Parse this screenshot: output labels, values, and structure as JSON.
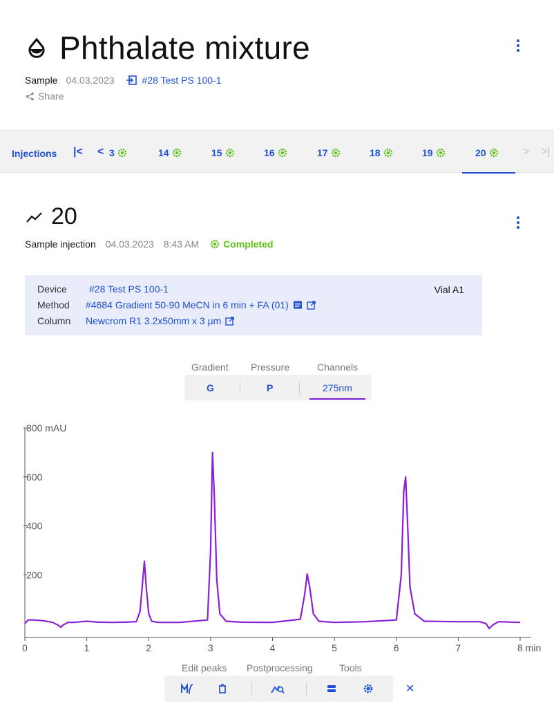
{
  "header": {
    "title": "Phthalate mixture",
    "sample_label": "Sample",
    "sample_date": "04.03.2023",
    "device_link": "#28 Test PS 100-1",
    "share_label": "Share"
  },
  "injections": {
    "label": "Injections",
    "items": [
      {
        "num": "3"
      },
      {
        "num": "14"
      },
      {
        "num": "15"
      },
      {
        "num": "16"
      },
      {
        "num": "17"
      },
      {
        "num": "18"
      },
      {
        "num": "19"
      },
      {
        "num": "20",
        "active": true
      }
    ]
  },
  "run": {
    "number": "20",
    "type_label": "Sample injection",
    "date": "04.03.2023",
    "time": "8:43 AM",
    "status": "Completed"
  },
  "info": {
    "device_key": "Device",
    "device_val": "#28 Test PS 100-1",
    "method_key": "Method",
    "method_val": "#4684 Gradient 50-90 MeCN in 6 min + FA (01)",
    "column_key": "Column",
    "column_val": "Newcrom R1 3.2x50mm x 3 µm",
    "vial": "Vial A1"
  },
  "view_tabs": {
    "gradient_label": "Gradient",
    "pressure_label": "Pressure",
    "channels_label": "Channels",
    "gradient_btn": "G",
    "pressure_btn": "P",
    "channel_btn": "275nm"
  },
  "chart_data": {
    "type": "line",
    "ylabel_unit": "mAU",
    "xlabel_unit": "min",
    "xlim": [
      0,
      8
    ],
    "ylim": [
      -50,
      800
    ],
    "x_ticks": [
      "0",
      "1",
      "2",
      "3",
      "4",
      "5",
      "6",
      "7",
      "8 min"
    ],
    "y_ticks": [
      "800 mAU",
      "600",
      "400",
      "200"
    ],
    "y_tick_values": [
      800,
      600,
      400,
      200
    ],
    "grid": false,
    "series": [
      {
        "color": "#8a1fd6",
        "x": [
          0.0,
          0.05,
          0.15,
          0.3,
          0.45,
          0.55,
          0.58,
          0.62,
          0.7,
          0.8,
          0.9,
          1.0,
          1.2,
          1.4,
          1.6,
          1.8,
          1.86,
          1.9,
          1.93,
          1.96,
          2.0,
          2.05,
          2.15,
          2.5,
          2.95,
          3.0,
          3.03,
          3.06,
          3.1,
          3.15,
          3.25,
          3.5,
          4.0,
          4.45,
          4.52,
          4.56,
          4.6,
          4.66,
          4.75,
          5.0,
          5.5,
          6.0,
          6.08,
          6.12,
          6.15,
          6.18,
          6.22,
          6.3,
          6.45,
          7.0,
          7.35,
          7.45,
          7.5,
          7.56,
          7.65,
          8.0
        ],
        "y": [
          0,
          15,
          15,
          12,
          5,
          -8,
          -15,
          -5,
          5,
          5,
          8,
          10,
          6,
          5,
          6,
          8,
          50,
          165,
          255,
          150,
          40,
          10,
          5,
          5,
          15,
          300,
          700,
          520,
          180,
          40,
          10,
          6,
          5,
          18,
          120,
          203,
          150,
          40,
          10,
          5,
          8,
          15,
          200,
          540,
          600,
          420,
          150,
          40,
          10,
          8,
          8,
          0,
          -20,
          -5,
          8,
          5
        ]
      }
    ]
  },
  "tools": {
    "edit_peaks_label": "Edit peaks",
    "postprocessing_label": "Postprocessing",
    "tools_label": "Tools"
  },
  "colors": {
    "accent": "#1f4fd6",
    "success": "#5cc21a",
    "trace": "#8a1fd6",
    "info_bg": "#e8ecfb"
  }
}
